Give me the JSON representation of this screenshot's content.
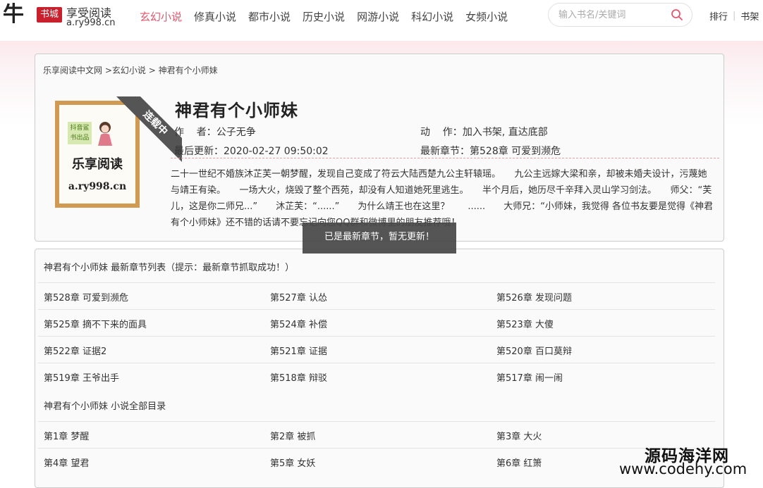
{
  "header": {
    "logo": {
      "big_char": "牛",
      "stamp": "书城",
      "tagline": "享受阅读",
      "url": "a.ry998.cn"
    },
    "nav": [
      {
        "label": "玄幻小说",
        "active": true
      },
      {
        "label": "修真小说",
        "active": false
      },
      {
        "label": "都市小说",
        "active": false
      },
      {
        "label": "历史小说",
        "active": false
      },
      {
        "label": "网游小说",
        "active": false
      },
      {
        "label": "科幻小说",
        "active": false
      },
      {
        "label": "女频小说",
        "active": false
      }
    ],
    "search_placeholder": "输入书名/关键词",
    "links": [
      "排行",
      "书架"
    ]
  },
  "breadcrumb": {
    "home": "乐享阅读中文网",
    "category": "玄幻小说",
    "book": "神君有个小师妹"
  },
  "book": {
    "title": "神君有个小师妹",
    "status_ribbon": "连载中",
    "cover": {
      "mini_label": "抖音鲨书出品",
      "line1": "乐享阅读",
      "line2": "a.ry998.cn"
    },
    "author_label": "作    者：",
    "author": "公子无争",
    "actions_label": "动    作：",
    "actions": "加入书架, 直达底部",
    "updated_label": "最后更新：",
    "updated": "2020-02-27 09:50:02",
    "latest_label": "最新章节：",
    "latest": "第528章 可爱到濒危",
    "intro": "二十一世纪不婚族沐芷芙一朝梦醒，发现自己变成了符云大陆西楚九公主轩辕瑶。　　九公主远嫁大梁和亲，却被未婚夫设计，污蔑她与靖王有染。　　一场大火，烧毁了整个西苑，却没有人知道她死里逃生。　　半个月后，她历尽千辛拜入灵山学习剑法。　　师父：“芙儿，这是你二师兄...”　　沐芷芙：“......”　　为什么靖王也在这里？　　......　　大师兄：“小师妹，我觉得 各位书友要是觉得《神君有个小师妹》还不错的话请不要忘记向您QQ群和微博里的朋友推荐哦！"
  },
  "toast": "已是最新章节，暂无更新！",
  "latest_section": {
    "heading": "神君有个小师妹 最新章节列表（提示：最新章节抓取成功！）",
    "rows": [
      [
        "第528章 可爱到濒危",
        "第527章 认怂",
        "第526章 发现问题"
      ],
      [
        "第525章 摘不下来的面具",
        "第524章 补偿",
        "第523章 大傻"
      ],
      [
        "第522章 证据2",
        "第521章 证据",
        "第520章 百口莫辩"
      ],
      [
        "第519章 王爷出手",
        "第518章 辩驳",
        "第517章 闹一闹"
      ]
    ]
  },
  "all_section": {
    "heading": "神君有个小师妹 小说全部目录",
    "rows": [
      [
        "第1章 梦醒",
        "第2章 被抓",
        "第3章 大火"
      ],
      [
        "第4章 望君",
        "第5章 女妖",
        "第6章 红箫"
      ]
    ]
  },
  "watermark": {
    "line1": "源码海洋网",
    "line2": "www.codehy.com"
  },
  "colors": {
    "accent": "#e4566b",
    "ribbon": "#555555",
    "toast_bg": "#464646",
    "cover_frame": "#d19a52"
  }
}
